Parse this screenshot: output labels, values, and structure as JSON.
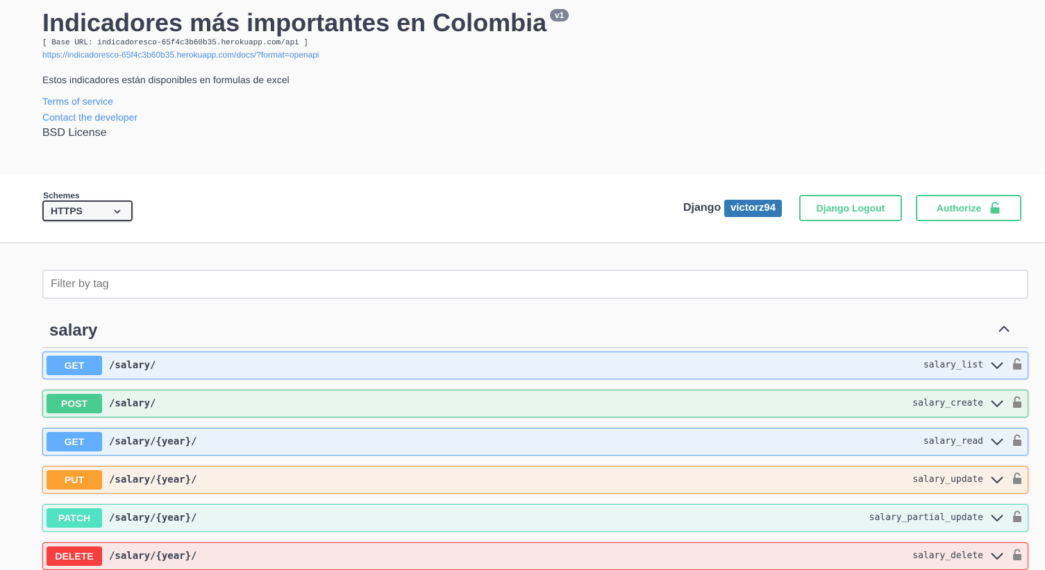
{
  "info": {
    "title": "Indicadores más importantes en Colombia",
    "version": "v1",
    "base_url": "[ Base URL: indicadoresco-65f4c3b60b35.herokuapp.com/api ]",
    "spec_link": "https://indicadoresco-65f4c3b60b35.herokuapp.com/docs/?format=openapi",
    "description": "Estos indicadores están disponibles en formulas de excel",
    "terms": "Terms of service",
    "contact": "Contact the developer",
    "license": "BSD License"
  },
  "schemes": {
    "label": "Schemes",
    "selected": "HTTPS"
  },
  "auth": {
    "django_label": "Django",
    "username": "victorz94",
    "logout_label": "Django Logout",
    "authorize_label": "Authorize"
  },
  "filter": {
    "placeholder": "Filter by tag"
  },
  "tag": {
    "name": "salary"
  },
  "operations": [
    {
      "method": "GET",
      "path": "/salary/",
      "operation_id": "salary_list"
    },
    {
      "method": "POST",
      "path": "/salary/",
      "operation_id": "salary_create"
    },
    {
      "method": "GET",
      "path": "/salary/{year}/",
      "operation_id": "salary_read"
    },
    {
      "method": "PUT",
      "path": "/salary/{year}/",
      "operation_id": "salary_update"
    },
    {
      "method": "PATCH",
      "path": "/salary/{year}/",
      "operation_id": "salary_partial_update"
    },
    {
      "method": "DELETE",
      "path": "/salary/{year}/",
      "operation_id": "salary_delete"
    }
  ],
  "colors": {
    "get": "#61affe",
    "post": "#49cc90",
    "put": "#fca130",
    "patch": "#50e3c2",
    "delete": "#f93e3e",
    "link": "#4990e2",
    "user_badge": "#337ab7"
  }
}
